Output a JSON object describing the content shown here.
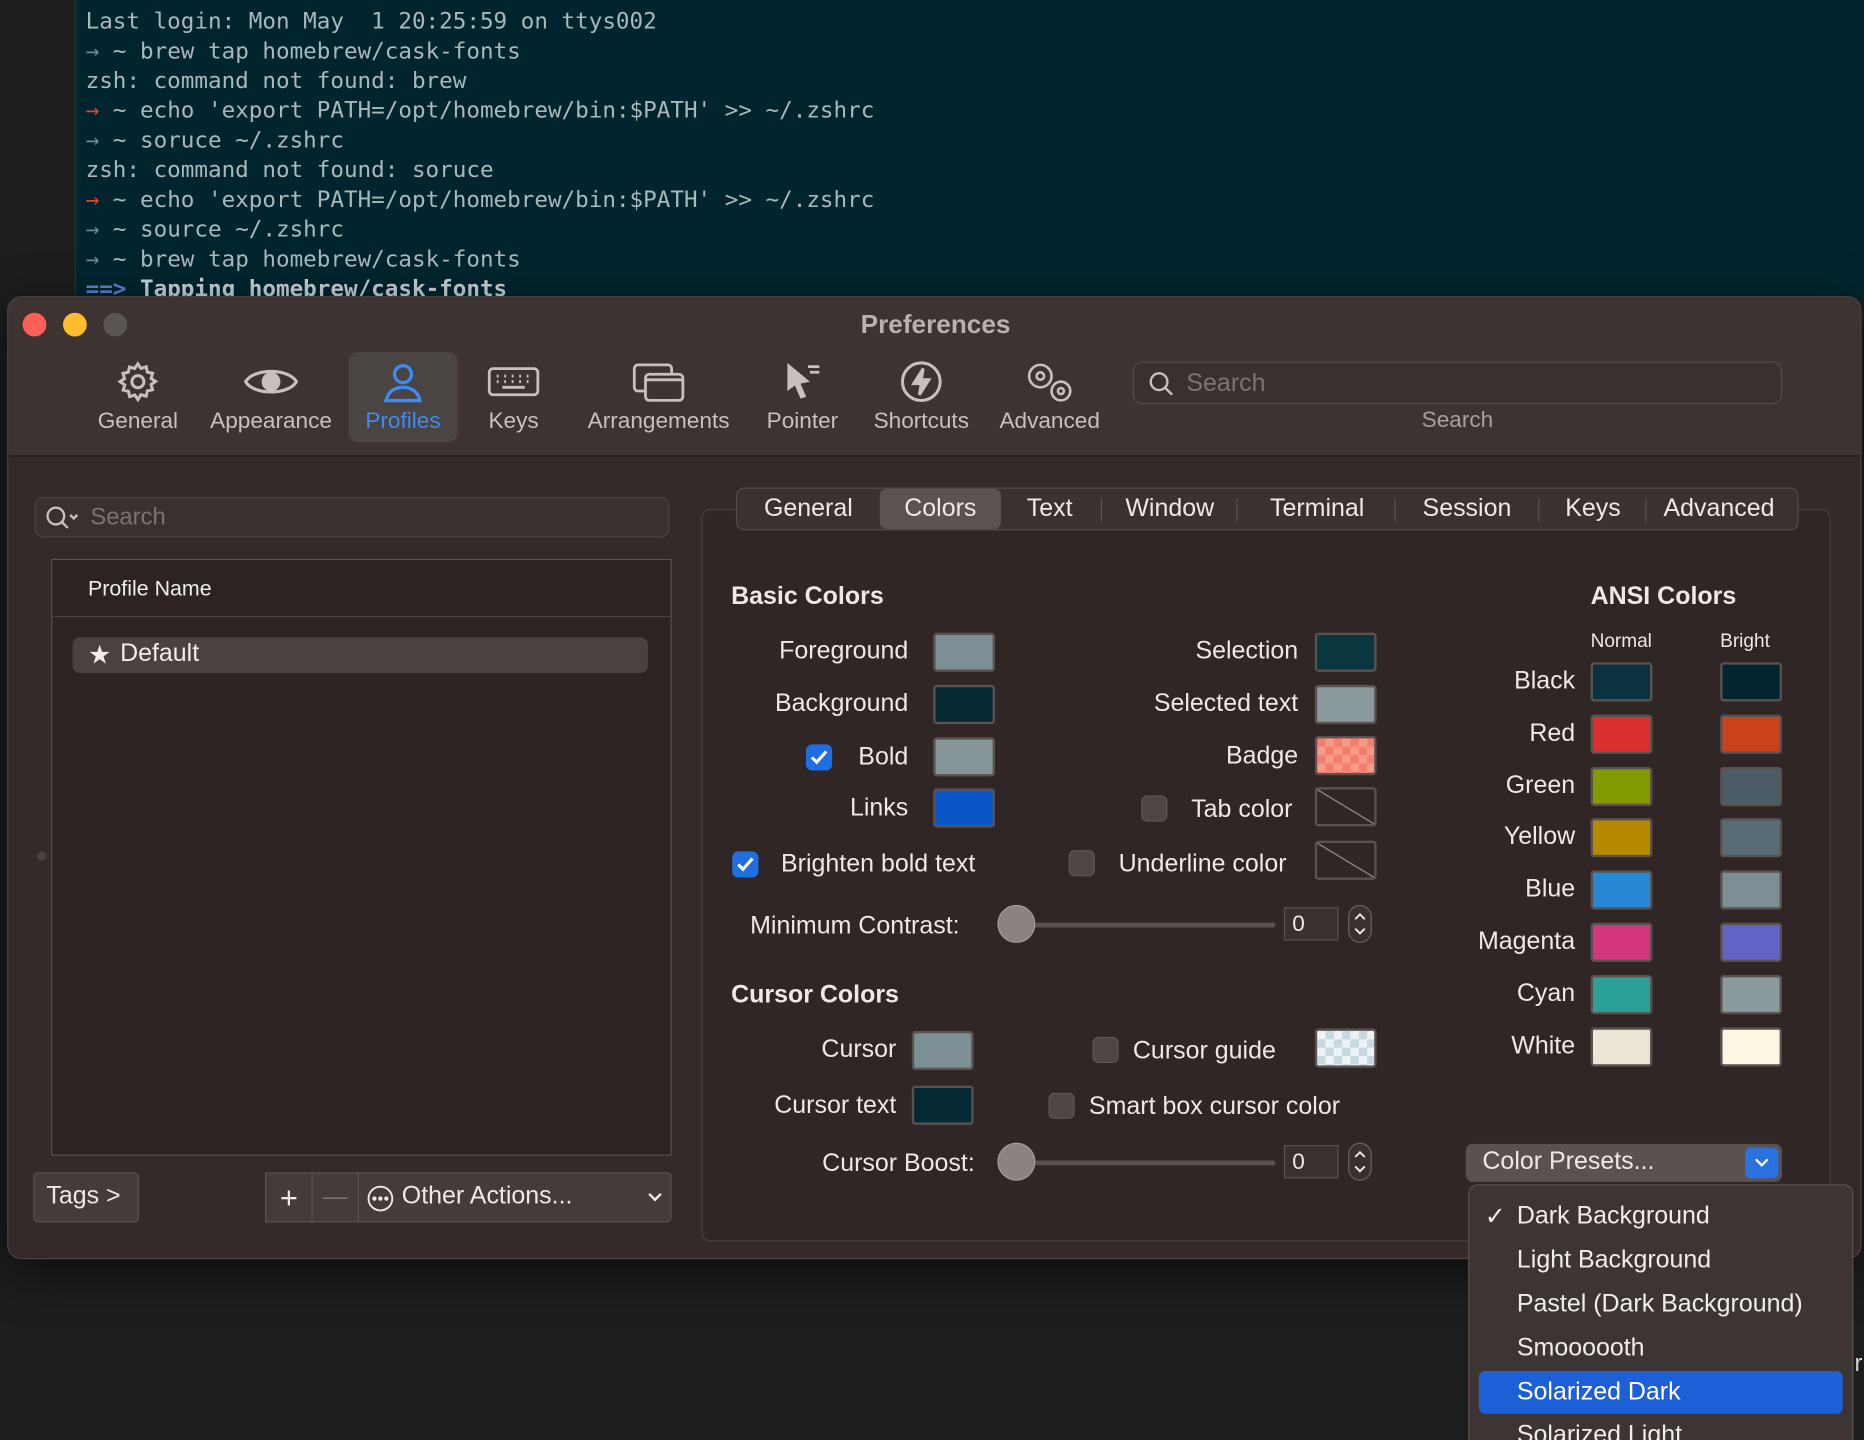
{
  "terminal": {
    "lines": [
      {
        "prefix": "",
        "text": "Last login: Mon May  1 20:25:59 on ttys002"
      },
      {
        "prefix": "→",
        "text": " ~ brew tap homebrew/cask-fonts"
      },
      {
        "prefix": "",
        "text": "zsh: command not found: brew"
      },
      {
        "prefix": "→",
        "text": " ~ echo 'export PATH=/opt/homebrew/bin:$PATH' >> ~/.zshrc"
      },
      {
        "prefix": "→",
        "text": " ~ soruce ~/.zshrc"
      },
      {
        "prefix": "",
        "text": "zsh: command not found: soruce"
      },
      {
        "prefix": "→",
        "text": " ~ echo 'export PATH=/opt/homebrew/bin:$PATH' >> ~/.zshrc"
      },
      {
        "prefix": "→",
        "text": " ~ source ~/.zshrc"
      },
      {
        "prefix": "→",
        "text": " ~ brew tap homebrew/cask-fonts"
      },
      {
        "prefix": "==>",
        "text": " Tapping homebrew/cask-fonts"
      }
    ]
  },
  "window": {
    "title": "Preferences",
    "toolbar": [
      "General",
      "Appearance",
      "Profiles",
      "Keys",
      "Arrangements",
      "Pointer",
      "Shortcuts",
      "Advanced"
    ],
    "search_placeholder": "Search",
    "search_label": "Search"
  },
  "profiles": {
    "search_placeholder": "Search",
    "column_header": "Profile Name",
    "items": [
      "Default"
    ],
    "tags_button": "Tags >",
    "add_symbol": "+",
    "remove_symbol": "—",
    "other_actions": "Other Actions..."
  },
  "tabs": [
    "General",
    "Colors",
    "Text",
    "Window",
    "Terminal",
    "Session",
    "Keys",
    "Advanced"
  ],
  "basic_colors": {
    "heading": "Basic Colors",
    "foreground": "Foreground",
    "background": "Background",
    "bold": "Bold",
    "links": "Links",
    "selection": "Selection",
    "selected_text": "Selected text",
    "badge": "Badge",
    "tab_color": "Tab color",
    "brighten_bold": "Brighten bold text",
    "underline_color": "Underline color",
    "min_contrast_label": "Minimum Contrast:",
    "min_contrast_value": "0",
    "colors": {
      "foreground": "#7b8f94",
      "background": "#062a33",
      "bold": "#859597",
      "links": "#0a55c6",
      "selection": "#0a3640",
      "selected_text": "#8a9a9d",
      "badge": "#f47e6c"
    }
  },
  "cursor_colors": {
    "heading": "Cursor Colors",
    "cursor": "Cursor",
    "cursor_text": "Cursor text",
    "cursor_guide": "Cursor guide",
    "smart_box": "Smart box cursor color",
    "boost_label": "Cursor Boost:",
    "boost_value": "0",
    "colors": {
      "cursor": "#7b8f94",
      "cursor_text": "#062a33"
    }
  },
  "ansi": {
    "heading": "ANSI Colors",
    "normal_label": "Normal",
    "bright_label": "Bright",
    "rows": [
      {
        "name": "Black",
        "normal": "#0a3240",
        "bright": "#032530"
      },
      {
        "name": "Red",
        "normal": "#dc302f",
        "bright": "#c9421c"
      },
      {
        "name": "Green",
        "normal": "#839a00",
        "bright": "#4a5d66"
      },
      {
        "name": "Yellow",
        "normal": "#b58a00",
        "bright": "#576c75"
      },
      {
        "name": "Blue",
        "normal": "#2788d6",
        "bright": "#7b8f94"
      },
      {
        "name": "Magenta",
        "normal": "#d3367f",
        "bright": "#6263c4"
      },
      {
        "name": "Cyan",
        "normal": "#2aa098",
        "bright": "#8a9a9d"
      },
      {
        "name": "White",
        "normal": "#ebe6d3",
        "bright": "#fcf6e3"
      }
    ]
  },
  "color_presets": {
    "label": "Color Presets...",
    "items": [
      "Dark Background",
      "Light Background",
      "Pastel (Dark Background)",
      "Smoooooth",
      "Solarized Dark",
      "Solarized Light"
    ],
    "checked": "Dark Background",
    "highlighted": "Solarized Dark"
  }
}
